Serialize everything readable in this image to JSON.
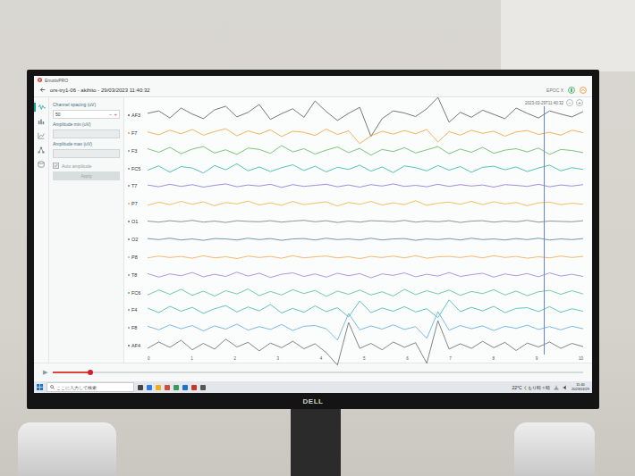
{
  "app": {
    "title": "EmotivPRO",
    "session": "ors-try1-06 - akihito - 29/03/2023 11:40:32",
    "device": "EPOC X"
  },
  "sidebar": {
    "items": [
      {
        "selected": true
      },
      {
        "selected": false
      },
      {
        "selected": false
      },
      {
        "selected": false
      },
      {
        "selected": false
      }
    ]
  },
  "settings": {
    "fields": [
      {
        "label": "Channel spacing (uV)",
        "value": "50",
        "disabled": false,
        "steppers": [
          "−",
          "+"
        ]
      },
      {
        "label": "Amplitude min (uV)",
        "disabled": true
      },
      {
        "label": "Amplitude max (uV)",
        "disabled": true
      }
    ],
    "checkbox": {
      "label": "Auto amplitude",
      "checked": true,
      "disabled": true
    },
    "button": {
      "label": "Apply",
      "disabled": true
    }
  },
  "chart": {
    "timestamp": "2023-03-29T11:40:32",
    "zoom_buttons": [
      "−",
      "+"
    ],
    "x_ticks": [
      "0",
      "1",
      "2",
      "3",
      "4",
      "5",
      "6",
      "7",
      "8",
      "9",
      "10"
    ],
    "cursor_level": 0.91,
    "spacing_uv": 50,
    "channels": [
      {
        "name": "AF3",
        "color": "#555555",
        "values": [
          5,
          12,
          -8,
          20,
          3,
          -10,
          15,
          25,
          -5,
          8,
          30,
          -12,
          4,
          18,
          -6,
          40,
          10,
          -15,
          5,
          22,
          -60,
          -10,
          12,
          6,
          -4,
          18,
          50,
          -20,
          8,
          -6,
          14,
          2,
          -10,
          20,
          5,
          -8,
          12,
          3,
          -5,
          10
        ]
      },
      {
        "name": "F7",
        "color": "#f0a030",
        "values": [
          3,
          -5,
          8,
          -2,
          10,
          -6,
          4,
          12,
          -8,
          6,
          -3,
          9,
          -10,
          5,
          2,
          -7,
          11,
          -4,
          6,
          -30,
          -8,
          5,
          -3,
          7,
          -2,
          10,
          -25,
          4,
          -6,
          8,
          -1,
          5,
          -9,
          3,
          7,
          -4,
          2,
          -6,
          8,
          1
        ]
      },
      {
        "name": "F3",
        "color": "#5cb85c",
        "values": [
          6,
          -4,
          10,
          -8,
          5,
          12,
          -6,
          3,
          -10,
          8,
          4,
          -7,
          15,
          -3,
          6,
          -9,
          2,
          11,
          -5,
          7,
          -12,
          4,
          -2,
          9,
          -6,
          3,
          12,
          -8,
          5,
          -4,
          10,
          -7,
          2,
          6,
          -3,
          8,
          -10,
          4,
          1,
          -5
        ]
      },
      {
        "name": "FC5",
        "color": "#2bb5a0",
        "values": [
          -4,
          8,
          -10,
          6,
          2,
          -12,
          9,
          -3,
          14,
          -6,
          5,
          -8,
          3,
          11,
          -5,
          7,
          -9,
          4,
          -2,
          10,
          -7,
          5,
          -11,
          8,
          3,
          -6,
          9,
          -4,
          6,
          -10,
          4,
          7,
          -3,
          5,
          -8,
          2,
          10,
          -6,
          3,
          -2
        ]
      },
      {
        "name": "T7",
        "color": "#8a6fd1",
        "values": [
          2,
          -3,
          4,
          -2,
          3,
          -4,
          1,
          5,
          -3,
          2,
          -1,
          4,
          -5,
          3,
          -2,
          1,
          4,
          -3,
          2,
          -4,
          3,
          -1,
          5,
          -2,
          1,
          -3,
          4,
          -2,
          3,
          -1,
          2,
          -4,
          3,
          1,
          -2,
          4,
          -3,
          2,
          -1,
          3
        ]
      },
      {
        "name": "P7",
        "color": "#f0b040",
        "values": [
          -5,
          4,
          -3,
          6,
          -2,
          5,
          -6,
          3,
          -1,
          7,
          -4,
          2,
          -5,
          6,
          -3,
          1,
          5,
          -7,
          3,
          -2,
          6,
          -4,
          2,
          -3,
          8,
          -5,
          1,
          4,
          -2,
          6,
          -3,
          5,
          -1,
          3,
          -6,
          2,
          4,
          -3,
          1,
          -2
        ]
      },
      {
        "name": "O1",
        "color": "#777777",
        "values": [
          1,
          -2,
          2,
          -1,
          3,
          -2,
          1,
          -3,
          2,
          0,
          -1,
          2,
          -2,
          1,
          3,
          -1,
          2,
          -3,
          1,
          -2,
          2,
          1,
          -1,
          3,
          -2,
          1,
          -1,
          2,
          -3,
          1,
          2,
          -2,
          1,
          -1,
          3,
          -2,
          1,
          0,
          -1,
          2
        ]
      },
      {
        "name": "O2",
        "color": "#5a7a9a",
        "values": [
          2,
          -1,
          3,
          -2,
          1,
          -3,
          2,
          1,
          -2,
          3,
          -1,
          2,
          -3,
          1,
          2,
          -2,
          3,
          -1,
          1,
          -2,
          3,
          -2,
          1,
          2,
          -3,
          1,
          -1,
          2,
          -2,
          3,
          -1,
          1,
          -2,
          2,
          -1,
          3,
          -2,
          1,
          -1,
          2
        ]
      },
      {
        "name": "P8",
        "color": "#f0a850",
        "values": [
          -2,
          3,
          -1,
          2,
          -3,
          4,
          -2,
          1,
          -4,
          3,
          -1,
          2,
          -3,
          4,
          -2,
          1,
          3,
          -2,
          1,
          -4,
          2,
          -1,
          3,
          -2,
          4,
          -3,
          1,
          2,
          -1,
          3,
          -2,
          4,
          -1,
          2,
          -3,
          1,
          -2,
          3,
          -1,
          2
        ]
      },
      {
        "name": "T8",
        "color": "#9b7fd8",
        "values": [
          4,
          -6,
          3,
          -2,
          7,
          -5,
          2,
          -4,
          8,
          -3,
          5,
          -7,
          2,
          6,
          -4,
          3,
          -6,
          5,
          -2,
          4,
          -8,
          3,
          -1,
          6,
          -5,
          2,
          -3,
          7,
          -4,
          1,
          5,
          -6,
          3,
          -2,
          4,
          -5,
          6,
          -3,
          2,
          -4
        ]
      },
      {
        "name": "FC6",
        "color": "#4fc08d",
        "values": [
          -6,
          8,
          -4,
          10,
          -7,
          5,
          -9,
          6,
          -3,
          11,
          -8,
          4,
          -6,
          9,
          -2,
          7,
          -10,
          5,
          -4,
          8,
          -6,
          3,
          -9,
          10,
          -5,
          6,
          -3,
          8,
          -7,
          4,
          -2,
          9,
          -6,
          5,
          -8,
          3,
          7,
          -4,
          6,
          -3
        ]
      },
      {
        "name": "F4",
        "color": "#3cb8a8",
        "values": [
          5,
          -8,
          10,
          -4,
          7,
          -10,
          3,
          12,
          -6,
          8,
          -3,
          15,
          -9,
          4,
          -7,
          11,
          -5,
          6,
          -20,
          25,
          -8,
          5,
          -4,
          9,
          -6,
          3,
          -22,
          28,
          -5,
          7,
          -3,
          10,
          -8,
          4,
          6,
          -5,
          9,
          -7,
          3,
          -4
        ]
      },
      {
        "name": "F8",
        "color": "#5aa8e0",
        "values": [
          4,
          -6,
          8,
          -3,
          6,
          -9,
          5,
          -4,
          10,
          -7,
          3,
          -5,
          9,
          -8,
          4,
          6,
          -3,
          -35,
          40,
          -6,
          5,
          -4,
          8,
          -5,
          3,
          -30,
          45,
          -7,
          6,
          -3,
          5,
          -8,
          4,
          -2,
          7,
          -5,
          3,
          -6,
          4,
          -3
        ]
      },
      {
        "name": "AF4",
        "color": "#666666",
        "values": [
          -8,
          10,
          -5,
          15,
          -12,
          6,
          -10,
          18,
          -4,
          9,
          -15,
          7,
          -6,
          12,
          -9,
          5,
          -20,
          -55,
          65,
          -8,
          6,
          -12,
          10,
          -5,
          8,
          -50,
          70,
          -10,
          5,
          -8,
          12,
          -6,
          9,
          -14,
          7,
          -4,
          10,
          -8,
          6,
          -3
        ]
      }
    ]
  },
  "playback": {
    "play": "▶",
    "level": 0.07
  },
  "taskbar": {
    "search": "ここに入力して検索",
    "weather": "22°C くもり時々晴",
    "time": "11:40",
    "date": "2023/03/29"
  },
  "monitor": {
    "brand": "DELL"
  }
}
